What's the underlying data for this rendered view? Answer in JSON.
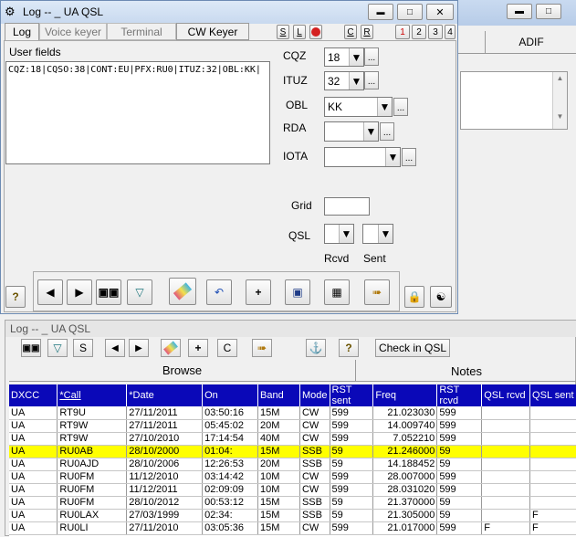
{
  "bg_window": {
    "adif_tab": "ADIF"
  },
  "main_window": {
    "title": "Log -- _ UA QSL",
    "tabs": [
      "Log",
      "Voice keyer",
      "Terminal",
      "CW Keyer"
    ],
    "small_buttons": [
      "S",
      "L",
      "C",
      "R"
    ],
    "page_buttons": [
      "1",
      "2",
      "3",
      "4"
    ],
    "user_fields_label": "User fields",
    "user_fields_text": "CQZ:18|CQSO:38|CONT:EU|PFX:RU0|ITUZ:32|OBL:KK|",
    "fields": {
      "cqz_label": "CQZ",
      "cqz_value": "18",
      "ituz_label": "ITUZ",
      "ituz_value": "32",
      "obl_label": "OBL",
      "obl_value": "KK",
      "rda_label": "RDA",
      "rda_value": "",
      "iota_label": "IOTA",
      "iota_value": "",
      "grid_label": "Grid",
      "grid_value": "",
      "qsl_label": "QSL",
      "rcvd_label": "Rcvd",
      "sent_label": "Sent"
    }
  },
  "log_window": {
    "title": "Log -- _ UA QSL",
    "toolbar_s": "S",
    "toolbar_c": "C",
    "check_in_qsl": "Check in QSL",
    "tab_browse": "Browse",
    "tab_notes": "Notes",
    "columns": [
      "DXCC",
      "*Call",
      "*Date",
      "On",
      "Band",
      "Mode",
      "RST sent",
      "Freq",
      "RST rcvd",
      "QSL rcvd",
      "QSL sent"
    ],
    "rows": [
      [
        "UA",
        "RT9U",
        "27/11/2011",
        "03:50:16",
        "15M",
        "CW",
        "599",
        "21.023030",
        "599",
        "",
        ""
      ],
      [
        "UA",
        "RT9W",
        "27/11/2011",
        "05:45:02",
        "20M",
        "CW",
        "599",
        "14.009740",
        "599",
        "",
        ""
      ],
      [
        "UA",
        "RT9W",
        "27/10/2010",
        "17:14:54",
        "40M",
        "CW",
        "599",
        "7.052210",
        "599",
        "",
        ""
      ],
      [
        "UA",
        "RU0AB",
        "28/10/2000",
        "01:04:",
        "15M",
        "SSB",
        "59",
        "21.246000",
        "59",
        "",
        ""
      ],
      [
        "UA",
        "RU0AJD",
        "28/10/2006",
        "12:26:53",
        "20M",
        "SSB",
        "59",
        "14.188452",
        "59",
        "",
        ""
      ],
      [
        "UA",
        "RU0FM",
        "11/12/2010",
        "03:14:42",
        "10M",
        "CW",
        "599",
        "28.007000",
        "599",
        "",
        ""
      ],
      [
        "UA",
        "RU0FM",
        "11/12/2011",
        "02:09:09",
        "10M",
        "CW",
        "599",
        "28.031020",
        "599",
        "",
        ""
      ],
      [
        "UA",
        "RU0FM",
        "28/10/2012",
        "00:53:12",
        "15M",
        "SSB",
        "59",
        "21.370000",
        "59",
        "",
        ""
      ],
      [
        "UA",
        "RU0LAX",
        "27/03/1999",
        "02:34:",
        "15M",
        "SSB",
        "59",
        "21.305000",
        "59",
        "",
        "F"
      ],
      [
        "UA",
        "RU0LI",
        "27/11/2010",
        "03:05:36",
        "15M",
        "CW",
        "599",
        "21.017000",
        "599",
        "F",
        "F"
      ]
    ],
    "highlight_row": 3
  },
  "colors": {
    "header_bg": "#0a08b8",
    "highlight": "#ffff00",
    "title_active": "#dbe7f5"
  }
}
